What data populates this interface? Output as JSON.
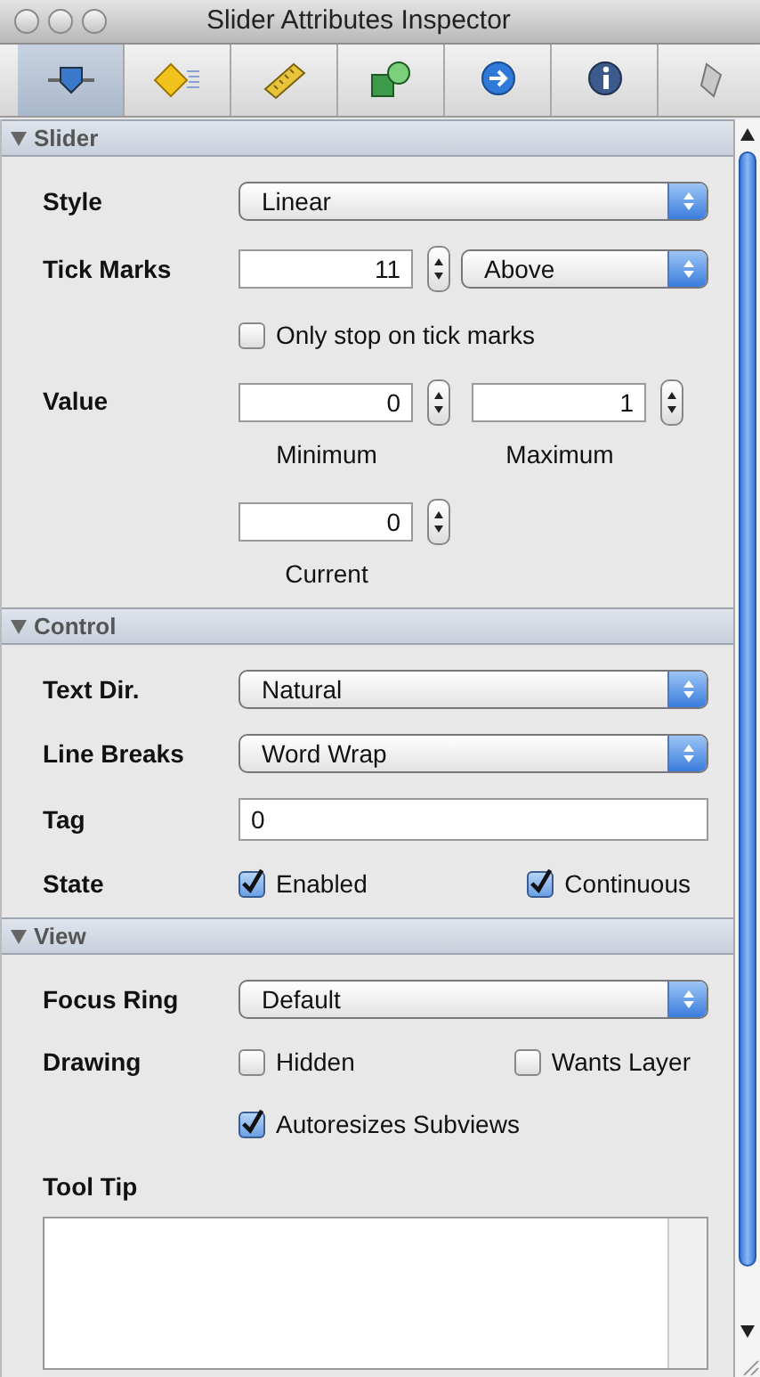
{
  "window": {
    "title": "Slider Attributes Inspector"
  },
  "toolbar": [
    {
      "kind": "slider",
      "selected": true
    },
    {
      "kind": "diamond",
      "selected": false
    },
    {
      "kind": "ruler",
      "selected": false
    },
    {
      "kind": "shapes",
      "selected": false
    },
    {
      "kind": "arrow",
      "selected": false
    },
    {
      "kind": "info",
      "selected": false
    },
    {
      "kind": "scroll",
      "selected": false
    }
  ],
  "sections": [
    {
      "title": "Slider",
      "expanded": true,
      "rows": [
        {
          "kind": "popup",
          "label": "Style",
          "value": "Linear"
        },
        {
          "kind": "stepper_popup",
          "label": "Tick Marks",
          "value": "11",
          "popup": "Above"
        },
        {
          "kind": "checks",
          "items": [
            {
              "label": "Only stop on tick marks",
              "checked": false
            }
          ]
        },
        {
          "kind": "steppers",
          "label": "Value",
          "fields": [
            {
              "value": "0",
              "caption": "Minimum"
            },
            {
              "value": "1",
              "caption": "Maximum"
            }
          ]
        },
        {
          "kind": "steppers",
          "fields": [
            {
              "value": "0",
              "caption": "Current"
            }
          ]
        }
      ]
    },
    {
      "title": "Control",
      "expanded": true,
      "rows": [
        {
          "kind": "popup",
          "label": "Text Dir.",
          "value": "Natural"
        },
        {
          "kind": "popup",
          "label": "Line Breaks",
          "value": "Word Wrap"
        },
        {
          "kind": "text",
          "label": "Tag",
          "value": "0"
        },
        {
          "kind": "checks",
          "label": "State",
          "items": [
            {
              "label": "Enabled",
              "checked": true
            },
            {
              "label": "Continuous",
              "checked": true
            }
          ]
        }
      ]
    },
    {
      "title": "View",
      "expanded": true,
      "rows": [
        {
          "kind": "popup",
          "label": "Focus Ring",
          "value": "Default"
        },
        {
          "kind": "checks",
          "label": "Drawing",
          "items": [
            {
              "label": "Hidden",
              "checked": false
            },
            {
              "label": "Wants Layer",
              "checked": false
            }
          ]
        },
        {
          "kind": "checks",
          "items": [
            {
              "label": "Autoresizes Subviews",
              "checked": true
            }
          ]
        },
        {
          "kind": "textarea",
          "label": "Tool Tip"
        }
      ]
    }
  ]
}
